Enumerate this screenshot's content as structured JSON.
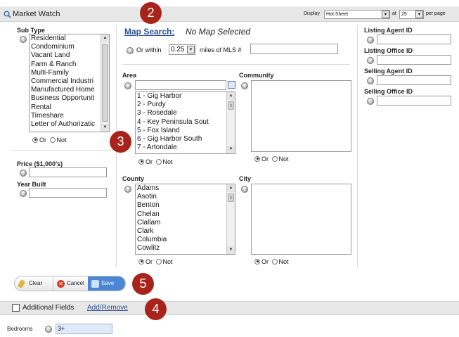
{
  "header": {
    "title": "Market Watch",
    "display_label": "Display",
    "display_value": "Hot Sheet",
    "at_label": "at",
    "per_page_value": "25",
    "per_page_label": "per page"
  },
  "sub_type": {
    "label": "Sub Type",
    "items": [
      "Residential",
      "Condominium",
      "Vacant Land",
      "Farm & Ranch",
      "Multi-Family",
      "Commercial Industri",
      "Manufactured Home",
      "Business Opportunit",
      "Rental",
      "Timeshare",
      "Letter of Authorizatic"
    ],
    "or_label": "Or",
    "not_label": "Not"
  },
  "price": {
    "label": "Price ($1,000's)"
  },
  "year_built": {
    "label": "Year Built"
  },
  "map_search": {
    "link": "Map Search:",
    "status": "No Map Selected",
    "within_label": "Or within",
    "within_value": "0.25",
    "miles_label": "miles of MLS #"
  },
  "area": {
    "label": "Area",
    "items": [
      "1 - Gig Harbor",
      "2 - Purdy",
      "3 - Rosedale",
      "4 - Key Peninsula Sout",
      "5 - Fox Island",
      "6 - Gig Harbor South",
      "7 - Artondale"
    ],
    "or_label": "Or",
    "not_label": "Not"
  },
  "community": {
    "label": "Community",
    "or_label": "Or",
    "not_label": "Not"
  },
  "county": {
    "label": "County",
    "items": [
      "Adams",
      "Asotin",
      "Benton",
      "Chelan",
      "Clallam",
      "Clark",
      "Columbia",
      "Cowlitz"
    ],
    "or_label": "Or",
    "not_label": "Not"
  },
  "city": {
    "label": "City",
    "or_label": "Or",
    "not_label": "Not"
  },
  "right_fields": {
    "listing_agent": "Listing Agent ID",
    "listing_office": "Listing Office ID",
    "selling_agent": "Selling Agent ID",
    "selling_office": "Selling Office ID"
  },
  "buttons": {
    "clear": "Clear",
    "cancel": "Cancel",
    "save": "Save"
  },
  "additional": {
    "label": "Additional Fields",
    "link": "Add/Remove"
  },
  "bedrooms": {
    "label": "Bedrooms",
    "value": "3+"
  },
  "markers": {
    "m2": "2",
    "m3": "3",
    "m4": "4",
    "m5": "5"
  },
  "icons": {
    "search": "magnifier-icon",
    "help": "help-icon",
    "clear": "broom-icon",
    "cancel": "x-circle-icon",
    "save": "disk-icon",
    "fields": "fields-icon"
  },
  "colors": {
    "marker": "#a8241a",
    "link": "#2a4f8f",
    "save_button": "#4a86d4"
  }
}
